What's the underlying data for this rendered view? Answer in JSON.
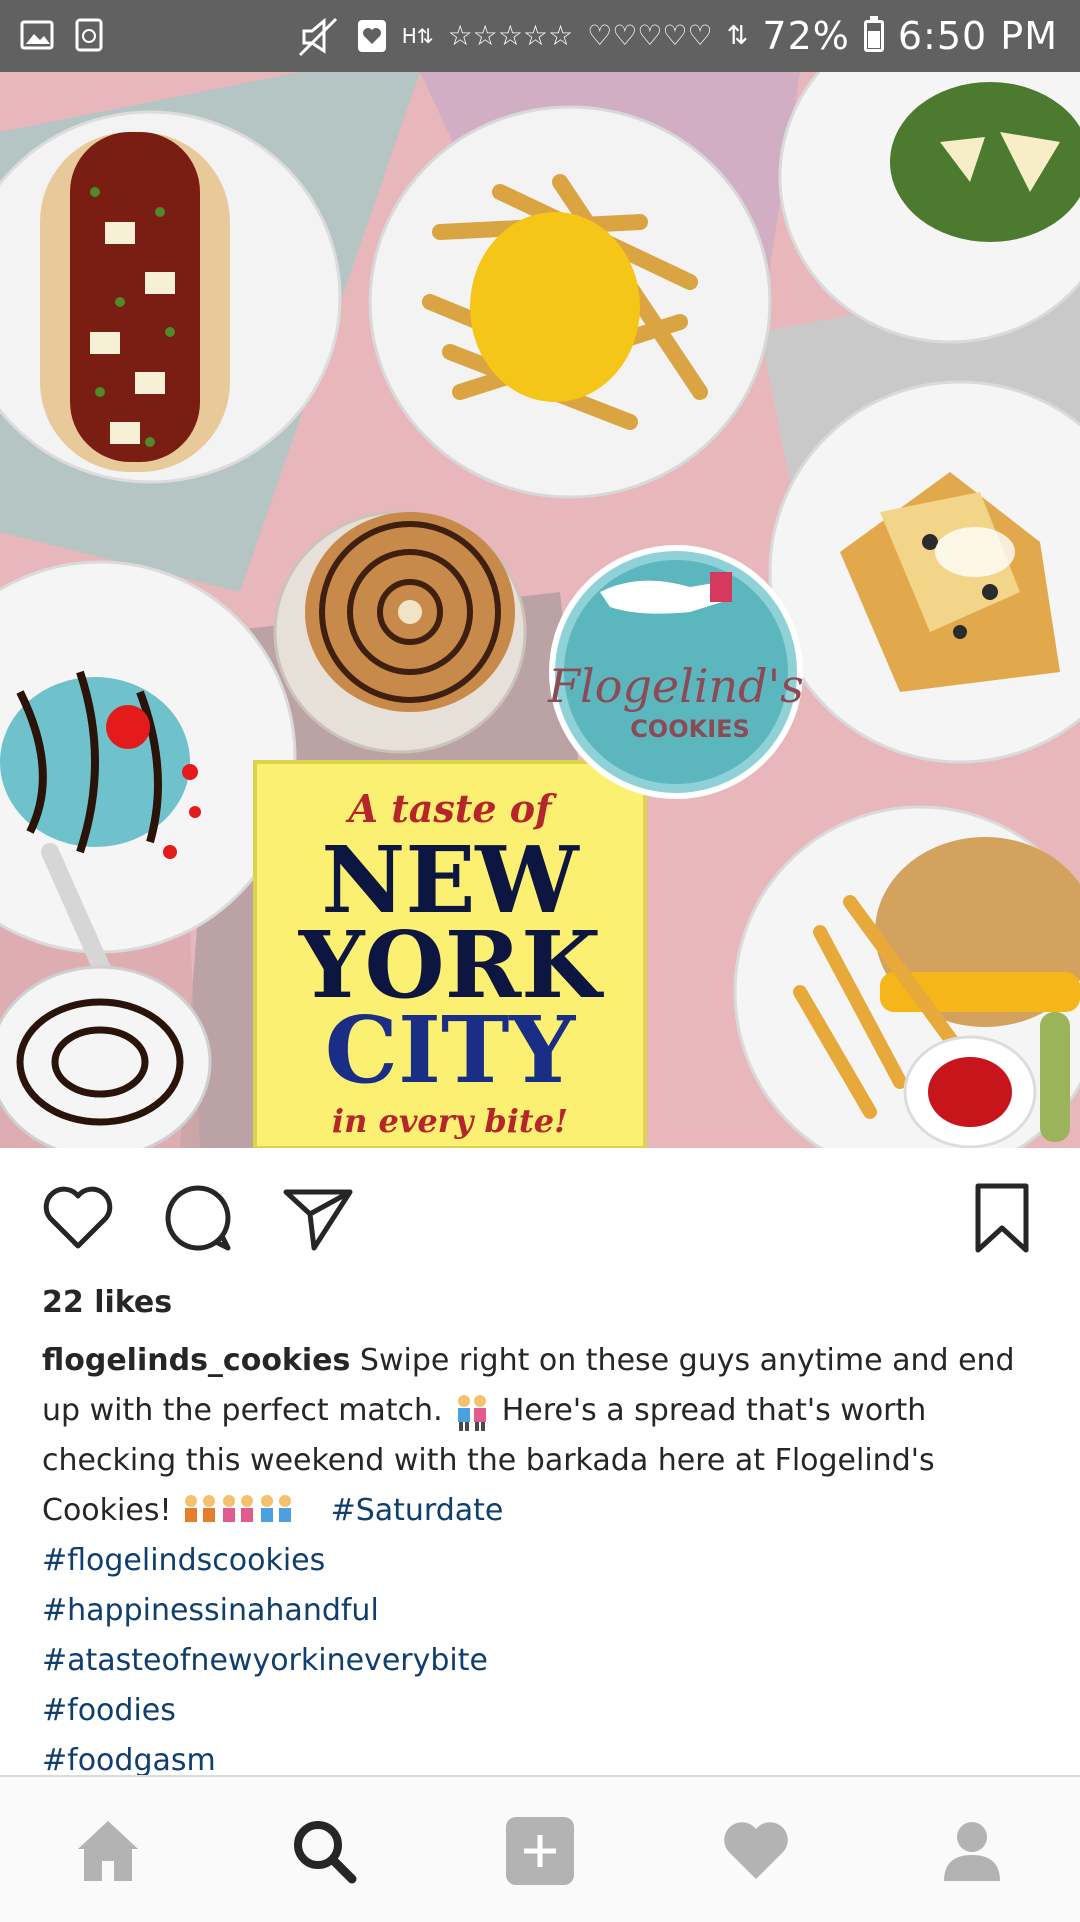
{
  "status_bar": {
    "battery_percent": "72%",
    "battery_level": 0.72,
    "time": "6:50 PM",
    "icons": [
      "gallery-icon",
      "recycle-icon",
      "mute-icon",
      "heart-badge-icon",
      "network-h-icon",
      "stars-icon",
      "hearts-icon",
      "signal-icon",
      "battery-icon"
    ]
  },
  "post": {
    "image": {
      "logo_script": "Flogelind's",
      "logo_sub": "COOKIES",
      "sign_line1": "A taste of",
      "sign_line2": "NEW",
      "sign_line3": "YORK",
      "sign_line4": "CITY",
      "sign_line5": "in every bite!"
    },
    "likes": "22 likes",
    "username": "flogelinds_cookies",
    "caption_text_1": " Swipe right on these guys anytime and end up with the perfect match.",
    "caption_text_2": " Here's a spread that's worth checking this weekend with the barkada here at Flogelind's Cookies!",
    "hashtags": [
      "#Saturdate",
      "#flogelindscookies",
      "#happinessinahandful",
      "#atasteofnewyorkineverybite",
      "#foodies",
      "#foodgasm"
    ]
  },
  "colors": {
    "status_bar": "#616161",
    "hashtag": "#0f3f6e",
    "icon_gray": "#b3b3b3",
    "text": "#262626"
  }
}
